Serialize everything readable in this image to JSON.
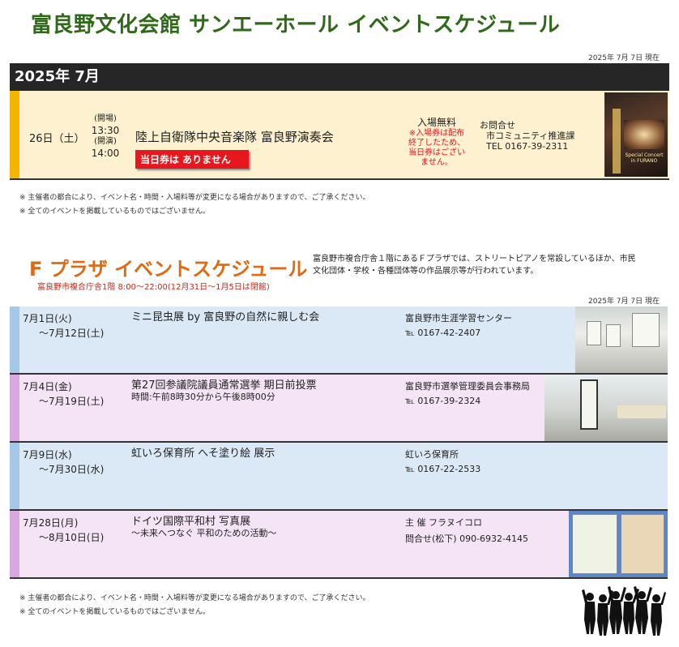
{
  "header": {
    "title": "富良野文化会館 サンエーホール イベントスケジュール",
    "as_of": "2025年 7月 7日 現在"
  },
  "hall": {
    "month_label": "2025年  7月",
    "event": {
      "date": "26日（土）",
      "open_label": "(開場)",
      "open_time": "13:30",
      "start_label": "(開演)",
      "start_time": "14:00",
      "title": "陸上自衛隊中央音楽隊 富良野演奏会",
      "badge": "当日券は ありません",
      "admission": "入場無料",
      "admission_note": "※入場券は配布終了したため、当日券はございません。",
      "contact_label": "お問合せ",
      "contact_org": "市コミュニティ推進課",
      "contact_tel": "TEL 0167-39-2311",
      "poster_caption": "Special Concert in FURANO"
    },
    "notes": [
      "※ 主催者の都合により、イベント名・時間・入場料等が変更になる場合がありますので、ご了承ください。",
      "※ 全てのイベントを掲載しているものではございません。"
    ]
  },
  "plaza": {
    "title": "F プラザ イベントスケジュール",
    "subtitle": "富良野市複合庁舎1階  8:00～22:00(12月31日～1月5日は閉館)",
    "description": "富良野市複合庁舎１階にあるＦプラザでは、ストリートピアノを常設しているほか、市民文化団体・学校・各種団体等の作品展示等が行われています。",
    "as_of": "2025年 7月 7日 現在",
    "events": [
      {
        "date_start": "7月1日(火)",
        "date_end": "～7月12日(土)",
        "title": "ミニ昆虫展 by 富良野の自然に親しむ会",
        "subtitle": "",
        "org": "富良野市生涯学習センター",
        "tel": "℡ 0167-42-2407"
      },
      {
        "date_start": "7月4日(金)",
        "date_end": "～7月19日(土)",
        "title": "第27回参議院議員通常選挙 期日前投票",
        "subtitle": "時間:午前8時30分から午後8時00分",
        "org": "富良野市選挙管理委員会事務局",
        "tel": "℡ 0167-39-2324"
      },
      {
        "date_start": "7月9日(水)",
        "date_end": "～7月30日(水)",
        "title": "虹いろ保育所 へそ塗り絵 展示",
        "subtitle": "",
        "org": "虹いろ保育所",
        "tel": "℡ 0167-22-2533"
      },
      {
        "date_start": "7月28日(月)",
        "date_end": "～8月10日(日)",
        "title": "ドイツ国際平和村 写真展",
        "subtitle": "～未来へつなぐ 平和のための活動～",
        "org": "主 催  フラヌイコロ",
        "tel": "問合せ(松下) 090-6932-4145"
      }
    ],
    "notes": [
      "※ 主催者の都合により、イベント名・時間・入場料等が変更になる場合がありますので、ご了承ください。",
      "※ 全てのイベントを掲載しているものではございません。"
    ]
  },
  "colors": {
    "title_green": "#2f6a1a",
    "plaza_orange": "#e06a12",
    "badge_red": "#e8171e",
    "hall_row_bg": "#fdf1cf",
    "hall_stripe": "#f5b400",
    "blue_row_bg": "#dbe8f5",
    "pink_row_bg": "#f5e4f5"
  }
}
